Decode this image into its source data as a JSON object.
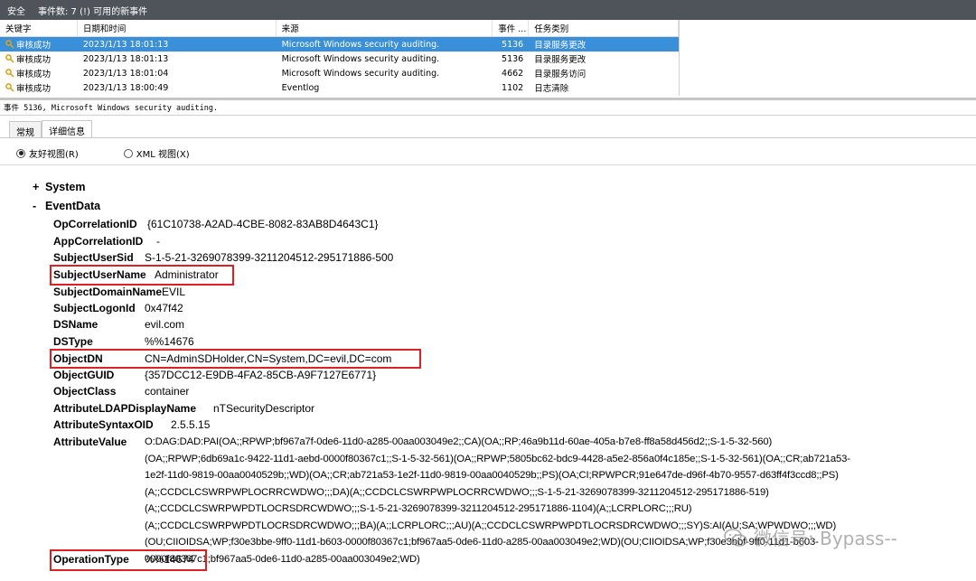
{
  "titlebar": {
    "log": "安全",
    "count": "事件数: 7 (!) 可用的新事件"
  },
  "grid": {
    "columns": [
      "关键字",
      "日期和时间",
      "来源",
      "事件 ...",
      "任务类别"
    ],
    "rows": [
      {
        "keyword": "审核成功",
        "datetime": "2023/1/13 18:01:13",
        "source": "Microsoft Windows security auditing.",
        "id": "5136",
        "task": "目录服务更改"
      },
      {
        "keyword": "审核成功",
        "datetime": "2023/1/13 18:01:13",
        "source": "Microsoft Windows security auditing.",
        "id": "5136",
        "task": "目录服务更改"
      },
      {
        "keyword": "审核成功",
        "datetime": "2023/1/13 18:01:04",
        "source": "Microsoft Windows security auditing.",
        "id": "4662",
        "task": "目录服务访问"
      },
      {
        "keyword": "审核成功",
        "datetime": "2023/1/13 18:00:49",
        "source": "Eventlog",
        "id": "1102",
        "task": "日志清除"
      }
    ]
  },
  "event_summary": "事件 5136, Microsoft Windows security auditing.",
  "tabs": {
    "general": "常规",
    "details": "详细信息"
  },
  "view_options": {
    "friendly": "友好视图(R)",
    "xml": "XML 视图(X)"
  },
  "system": {
    "toggle": "+",
    "label": "System"
  },
  "eventdata": {
    "toggle": "-",
    "label": "EventData",
    "fields": {
      "OpCorrelationID": {
        "key": "OpCorrelationID",
        "value": "{61C10738-A2AD-4CBE-8082-83AB8D4643C1}"
      },
      "AppCorrelationID": {
        "key": "AppCorrelationID",
        "value": "-"
      },
      "SubjectUserSid": {
        "key": "SubjectUserSid",
        "value": "S-1-5-21-3269078399-3211204512-295171886-500"
      },
      "SubjectUserName": {
        "key": "SubjectUserName",
        "value": "Administrator"
      },
      "SubjectDomainName": {
        "key": "SubjectDomainName",
        "value": "EVIL"
      },
      "SubjectLogonId": {
        "key": "SubjectLogonId",
        "value": "0x47f42"
      },
      "DSName": {
        "key": "DSName",
        "value": "evil.com"
      },
      "DSType": {
        "key": "DSType",
        "value": "%%14676"
      },
      "ObjectDN": {
        "key": "ObjectDN",
        "value": "CN=AdminSDHolder,CN=System,DC=evil,DC=com"
      },
      "ObjectGUID": {
        "key": "ObjectGUID",
        "value": "{357DCC12-E9DB-4FA2-85CB-A9F7127E6771}"
      },
      "ObjectClass": {
        "key": "ObjectClass",
        "value": "container"
      },
      "AttributeLDAPDisplayName": {
        "key": "AttributeLDAPDisplayName",
        "value": "nTSecurityDescriptor"
      },
      "AttributeSyntaxOID": {
        "key": "AttributeSyntaxOID",
        "value": "2.5.5.15"
      },
      "AttributeValue": {
        "key": "AttributeValue",
        "lines": [
          "O:DAG:DAD:PAI(OA;;RPWP;bf967a7f-0de6-11d0-a285-00aa003049e2;;CA)(OA;;RP;46a9b11d-60ae-405a-b7e8-ff8a58d456d2;;S-1-5-32-560)",
          "(OA;;RPWP;6db69a1c-9422-11d1-aebd-0000f80367c1;;S-1-5-32-561)(OA;;RPWP;5805bc62-bdc9-4428-a5e2-856a0f4c185e;;S-1-5-32-561)(OA;;CR;ab721a53-",
          "1e2f-11d0-9819-00aa0040529b;;WD)(OA;;CR;ab721a53-1e2f-11d0-9819-00aa0040529b;;PS)(OA;CI;RPWPCR;91e647de-d96f-4b70-9557-d63ff4f3ccd8;;PS)",
          "(A;;CCDCLCSWRPWPLOCRRCWDWO;;;DA)(A;;CCDCLCSWRPWPLOCRRCWDWO;;;S-1-5-21-3269078399-3211204512-295171886-519)",
          "(A;;CCDCLCSWRPWPDTLOCRSDRCWDWO;;;S-1-5-21-3269078399-3211204512-295171886-1104)(A;;LCRPLORC;;;RU)",
          "(A;;CCDCLCSWRPWPDTLOCRSDRCWDWO;;;BA)(A;;LCRPLORC;;;AU)(A;;CCDCLCSWRPWPDTLOCRSDRCWDWO;;;SY)S:AI(AU;SA;WPWDWO;;;WD)",
          "(OU;CIIOIDSA;WP;f30e3bbe-9ff0-11d1-b603-0000f80367c1;bf967aa5-0de6-11d0-a285-00aa003049e2;WD)(OU;CIIOIDSA;WP;f30e3bbf-9ff0-11d1-b603-",
          "0000f80367c1;bf967aa5-0de6-11d0-a285-00aa003049e2;WD)"
        ]
      },
      "OperationType": {
        "key": "OperationType",
        "value": "%%14674"
      }
    }
  },
  "watermark": "微信号: Bypass--"
}
